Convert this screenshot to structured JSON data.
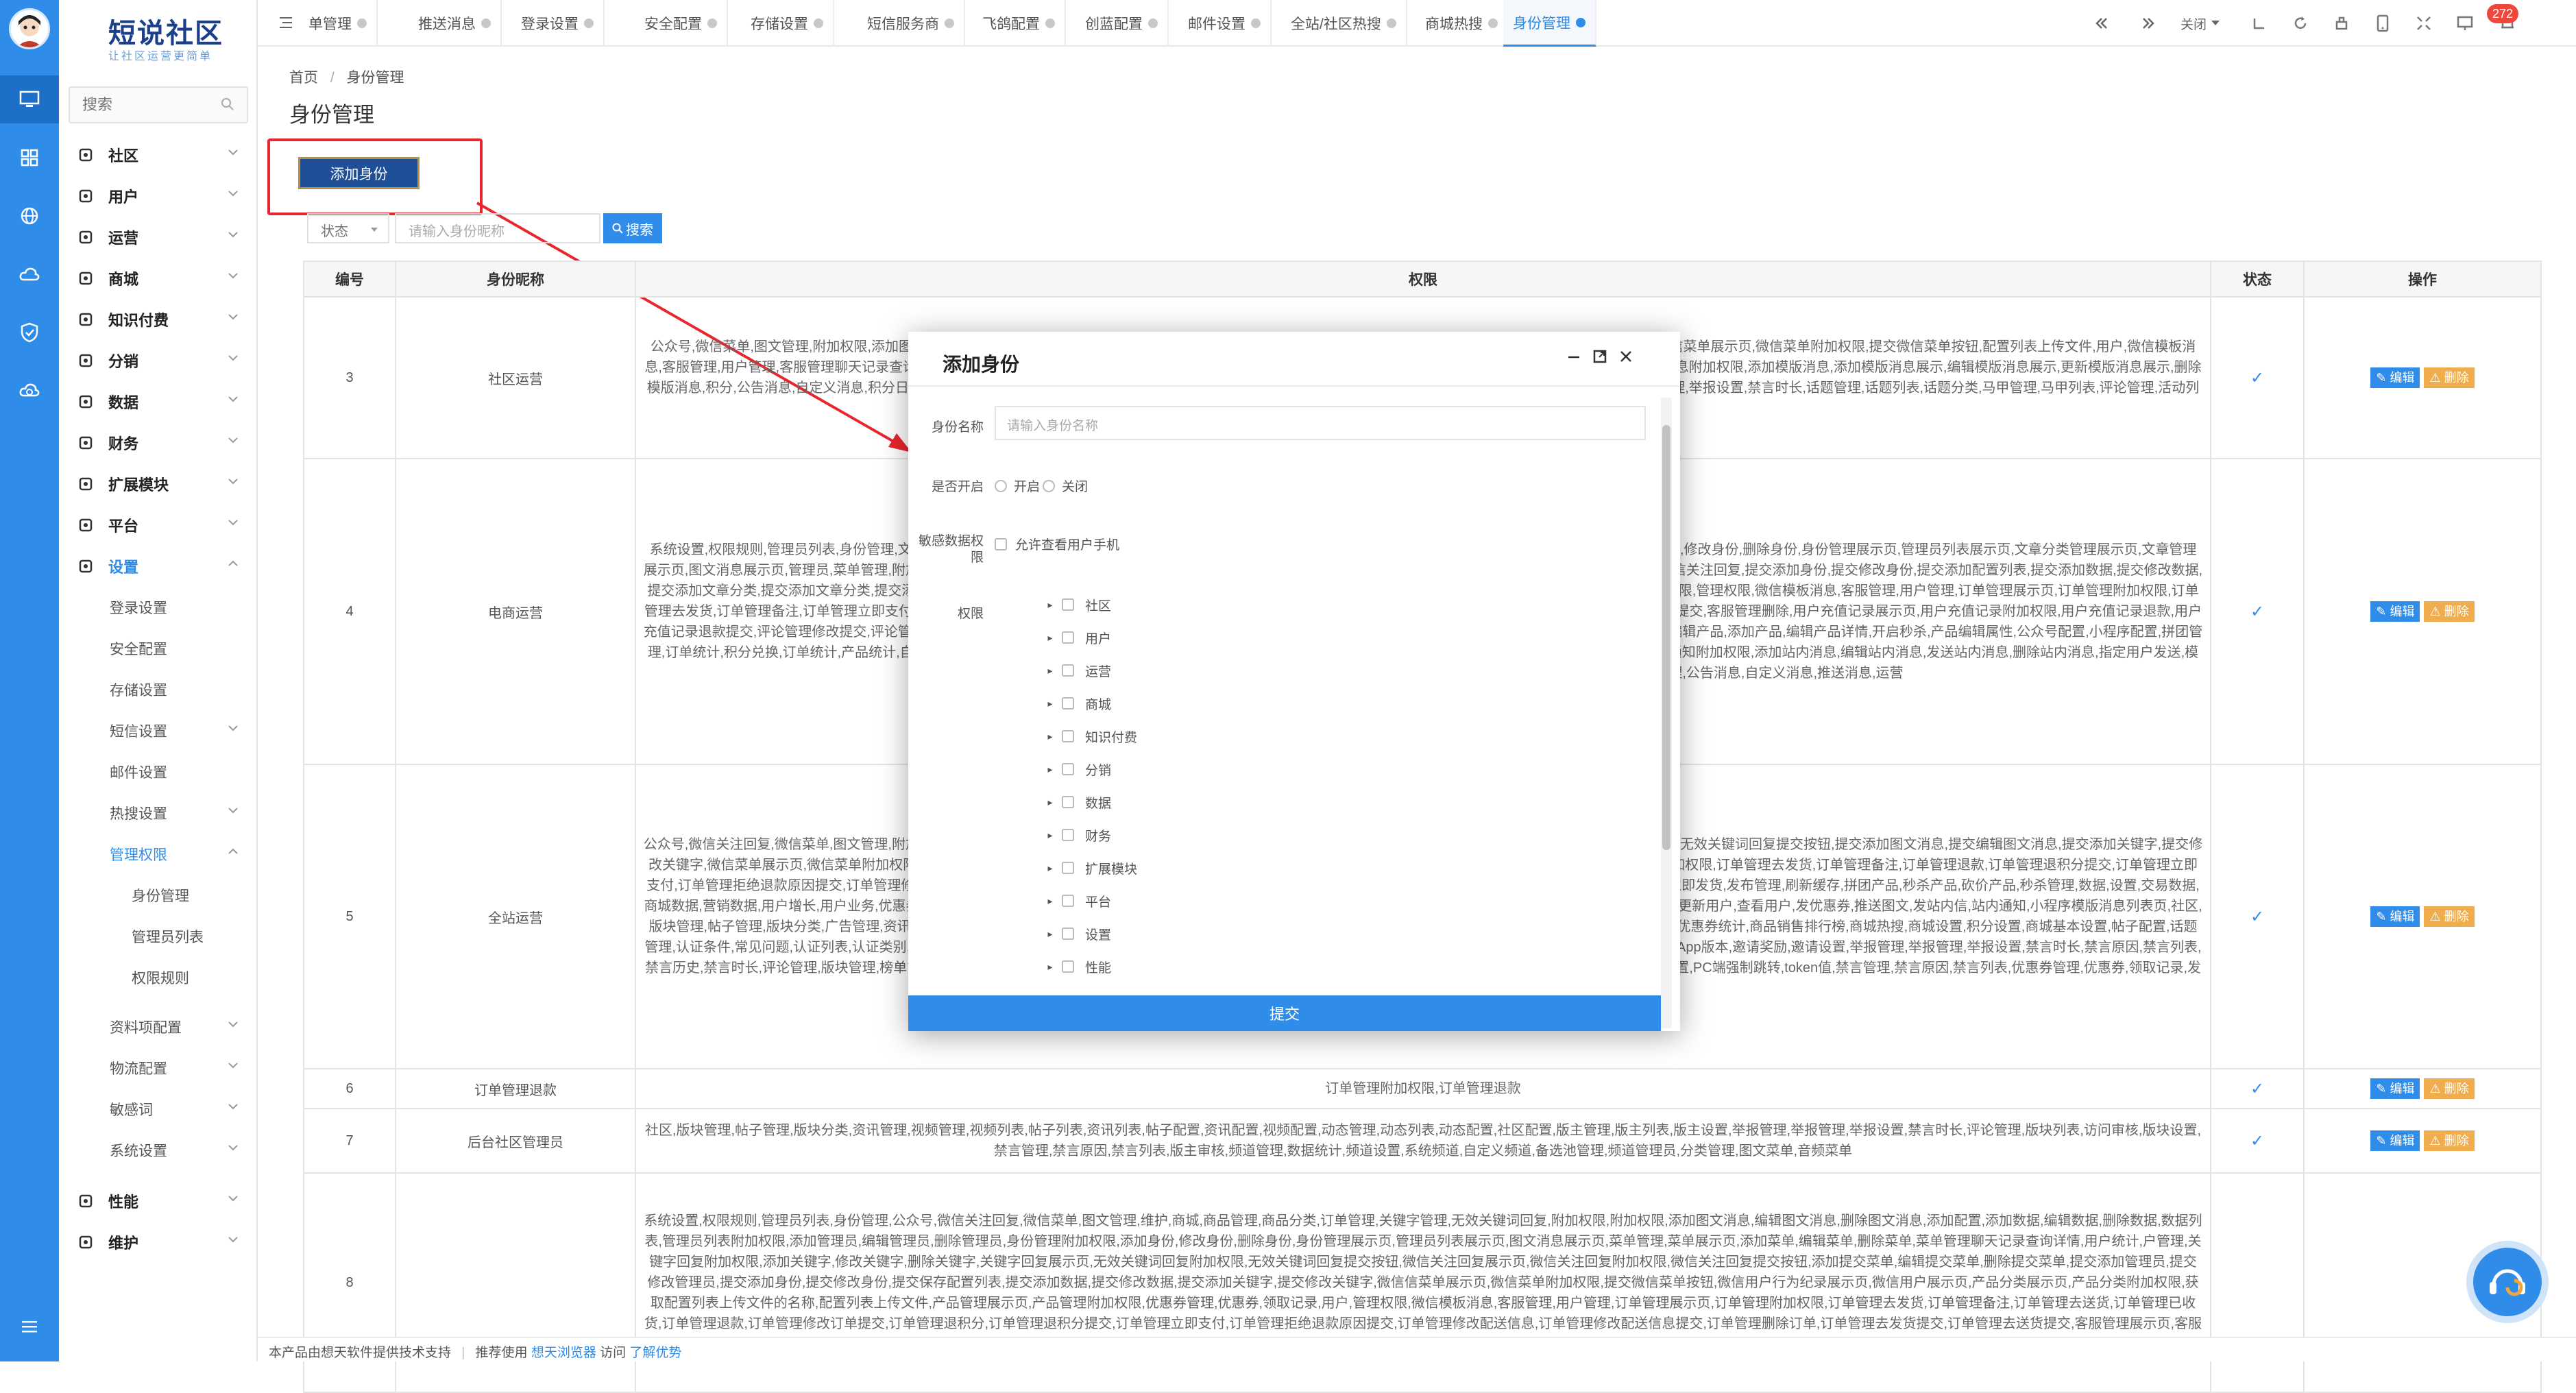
{
  "brand": {
    "title": "短说社区",
    "slogan": "让社区运营更简单"
  },
  "sidebar": {
    "search_placeholder": "搜索",
    "items": [
      {
        "label": "社区",
        "icon": "chat-icon"
      },
      {
        "label": "用户",
        "icon": "user-icon"
      },
      {
        "label": "运营",
        "icon": "operation-icon"
      },
      {
        "label": "商城",
        "icon": "store-icon"
      },
      {
        "label": "知识付费",
        "icon": "book-icon"
      },
      {
        "label": "分销",
        "icon": "share-icon"
      },
      {
        "label": "数据",
        "icon": "data-icon"
      },
      {
        "label": "财务",
        "icon": "finance-icon"
      },
      {
        "label": "扩展模块",
        "icon": "plugin-icon"
      },
      {
        "label": "平台",
        "icon": "platform-icon"
      },
      {
        "label": "设置",
        "icon": "gear-icon"
      }
    ],
    "settings_sub": [
      "登录设置",
      "安全配置",
      "存储设置",
      "短信设置",
      "邮件设置",
      "热搜设置",
      "管理权限"
    ],
    "perm_sub": [
      "身份管理",
      "管理员列表",
      "权限规则"
    ],
    "settings_sub2": [
      "资料项配置",
      "物流配置",
      "敏感词",
      "系统设置"
    ],
    "bottom": [
      {
        "label": "性能",
        "icon": "performance-icon"
      },
      {
        "label": "维护",
        "icon": "wrench-icon"
      }
    ]
  },
  "tabs": [
    "单管理",
    "推送消息",
    "登录设置",
    "安全配置",
    "存储设置",
    "短信服务商",
    "飞鸽配置",
    "创蓝配置",
    "邮件设置",
    "全站/社区热搜",
    "商城热搜",
    "身份管理"
  ],
  "toolbar": {
    "close_label": "关闭",
    "badge": "272"
  },
  "breadcrumb": {
    "home": "首页",
    "sep": "/",
    "current": "身份管理"
  },
  "page_title": "身份管理",
  "add_button": "添加身份",
  "filter": {
    "status": "状态",
    "name_placeholder": "请输入身份昵称",
    "search": "搜索"
  },
  "table": {
    "headers": [
      "编号",
      "身份昵称",
      "权限",
      "状态",
      "操作"
    ],
    "edit": "编辑",
    "del": "删除",
    "rows": [
      {
        "id": "3",
        "name": "社区运营",
        "perm": "公众号,微信菜单,图文管理,附加权限,添加图文消息,编辑图文消息,删除图文消息,图文消息展示页,微信用户管理,提交添加图文消息,提交编辑图文消息,提交保存配置列表,微信菜单展示页,微信菜单附加权限,提交微信菜单按钮,配置列表上传文件,用户,微信模板消息,客服管理,用户管理,客服管理聊天记录查询详情,用户统计,公众号配置,小程序配置,数据,设置,商城数据,用户增长,用户业务,公众号微信推送,推送图文,发站内信,微信模板消息附加权限,添加模版消息,添加模版消息展示,编辑模版消息展示,更新模版消息展示,删除模版消息,积分,公告消息,自定义消息,积分日志,积分商城,商品管理,订单管理,栏目管理,基础设置,邀请海报,认证特权,认证条件,常见问题,邀请奖励,邀请设置,举报管理,举报管理,举报设置,禁言时长,话题管理,话题列表,话题分类,马甲管理,马甲列表,评论管理,活动列表,活动分类,活动管理,活动配置,微信流量主广告,发布页广告,钱包设置,提"
      },
      {
        "id": "4",
        "name": "电商运营",
        "perm": "系统设置,权限规则,管理员列表,身份管理,文章分类,删除文章分类,附加权限,附加权限,添加文章,编辑文章,删除文章,附加权限,添加图文消息,编辑图文消息,附加权限,添加身份,修改身份,删除身份,身份管理展示页,管理员列表展示页,文章分类管理展示页,文章管理展示页,图文消息展示页,管理员,菜单管理,附加权限,修改关键字,删除关键字,关键字回复展示页,无效关键词回复展示页,无效关键词回复附加权限,无效关键词回复提交按钮,微信关注回复,提交添加身份,提交修改身份,提交添加配置列表,提交添加数据,提交修改数据,提交添加文章分类,提交添加文章分类,提交添加菜单展示页,微信菜单附加权限,提交微信菜单按钮,微信用户行为记录展示页,微信用户展示页,产品分类展示页,产品分类附加权限,管理权限,微信模板消息,客服管理,用户管理,订单管理展示页,订单管理附加权限,订单管理去发货,订单管理备注,订单管理立即支付,订单管理拒绝退款原因提交,订单管理修改配送信息,订单管理修改配送信息提交,订单管理修改数据,客服管理编辑,客服管理编辑提交,客服管理删除,用户充值记录展示页,用户充值记录附加权限,用户充值记录退款,用户充值记录退款提交,评论管理修改提交,评论管理删除评论,优惠券管理展示页,优惠券管理附加权限,优惠券管理添加,优惠券管理添加提交,优惠券管理删除,资料配置,后台通知,编辑产品,添加产品,编辑产品详情,开启秒杀,产品编辑属性,公众号配置,小程序配置,拼团管理,订单统计,积分兑换,订单统计,产品统计,自动回复,公众号微信支付,其它权限管理,编辑砍价,添加产品分类,编辑产品分类,物流公司,商户,发优惠券,推送图文,发站内信,站内通知附加权限,添加站内消息,编辑站内消息,发送站内消息,删除站内消息,指定用户发送,模版消息展示,小程序模版消息附加权限,添加模版消息展示,添加模版消息,编辑模版消息展示,编辑模版消息,飞鸽配置,广告管理,公告消息,自定义消息,推送消息,运营"
      },
      {
        "id": "5",
        "name": "全站运营",
        "perm": "公众号,微信关注回复,微信菜单,图文管理,附加权限,添加图文消息,图文消息展示页,微信用户管理,关键字回复附加权限,添加关键字,修改关键字,删除关键字,关键字回复展示页,无效关键词回复提交按钮,提交添加图文消息,提交编辑图文消息,提交添加关键字,提交修改关键字,微信菜单展示页,微信菜单附加权限,提交微信菜单按钮,附加权限,优惠券管理,优惠券,领取记录,用户,微信模板消息,客服管理,用户管理,订单管理展示页,订单管理附加权限,订单管理去发货,订单管理备注,订单管理退款,订单管理退积分提交,订单管理立即支付,订单管理拒绝退款原因提交,订单管理修改配送信息,客服管理聊天记录查询,客服管理添加,客服管理添加提交,客服管理编辑,客服管理编辑提交,客服管理删除,客服管理立即发货,发布管理,刷新缓存,拼团产品,秒杀产品,砍价产品,秒杀管理,数据,设置,交易数据,商城数据,营销数据,用户增长,用户业务,优惠券统计,拼团统计,秒杀统计,营销订单,拼团列表,秒杀列表,砍价列表,推送优惠券,会员列表页,会员用户管理,修改用户状态,编辑用户,更新用户,查看用户,发优惠券,推送图文,发站内信,站内通知,小程序模版消息列表页,社区,版块管理,帖子管理,版块分类,广告管理,资讯管理,视频管理,视频列表,帖子列表,资讯列表,用户等级,用户权限,积分,邀请奖励,邀请设置,举报管理,数据统计,订单统计,产品统计,优惠券统计,商品销售排行榜,商城热搜,商城设置,积分设置,商城基本设置,帖子配置,话题管理,认证条件,常见问题,认证列表,认证类别,认证配置,小程序,推送消息,运营,知识付费,作者管理,分销商,视频配置,分销配置,任务管理,社区配置,版主管理,版主列表,版主设置,App版本,邀请奖励,邀请设置,举报管理,举报管理,举报设置,禁言时长,禁言原因,禁言列表,禁言历史,禁言时长,评论管理,版块管理,榜单管理,评论管理,用户组,系统用户组,晋级用户组,会员用户组,认证用户组,自定义用户组,小程序微信支付,版块列表,访问审核,版块设置,PC端强制跳转,token值,禁言管理,禁言原因,禁言列表,优惠券管理,优惠券,领取记录,发布管理"
      },
      {
        "id": "6",
        "name": "订单管理退款",
        "perm": "订单管理附加权限,订单管理退款"
      },
      {
        "id": "7",
        "name": "后台社区管理员",
        "perm": "社区,版块管理,帖子管理,版块分类,资讯管理,视频管理,视频列表,帖子列表,资讯列表,帖子配置,资讯配置,视频配置,动态管理,动态列表,动态配置,社区配置,版主管理,版主列表,版主设置,举报管理,举报管理,举报设置,禁言时长,评论管理,版块列表,访问审核,版块设置,禁言管理,禁言原因,禁言列表,版主审核,频道管理,数据统计,频道设置,系统频道,自定义频道,备选池管理,频道管理员,分类管理,图文菜单,音频菜单"
      },
      {
        "id": "8",
        "name": "",
        "perm": "系统设置,权限规则,管理员列表,身份管理,公众号,微信关注回复,微信菜单,图文管理,维护,商城,商品管理,商品分类,订单管理,关键字管理,无效关键词回复,附加权限,附加权限,添加图文消息,编辑图文消息,删除图文消息,添加配置,添加数据,编辑数据,删除数据,数据列表,管理员列表附加权限,添加管理员,编辑管理员,删除管理员,身份管理附加权限,添加身份,修改身份,删除身份,身份管理展示页,管理员列表展示页,图文消息展示页,菜单管理,菜单展示页,添加菜单,编辑菜单,删除菜单,菜单管理聊天记录查询详情,用户统计,户管理,关键字回复附加权限,添加关键字,修改关键字,删除关键字,关键字回复展示页,无效关键词回复附加权限,无效关键词回复提交按钮,微信关注回复展示页,微信关注回复附加权限,微信关注回复提交按钮,添加提交菜单,编辑提交菜单,删除提交菜单,提交添加管理员,提交修改管理员,提交添加身份,提交修改身份,提交保存配置列表,提交添加数据,提交修改数据,提交添加关键字,提交修改关键字,微信信菜单展示页,微信菜单附加权限,提交微信菜单按钮,微信用户行为纪录展示页,微信用户展示页,产品分类展示页,产品分类附加权限,获取配置列表上传文件的名称,配置列表上传文件,产品管理展示页,产品管理附加权限,优惠券管理,优惠券,领取记录,用户,管理权限,微信模板消息,客服管理,用户管理,订单管理展示页,订单管理附加权限,订单管理去发货,订单管理备注,订单管理去送货,订单管理已收货,订单管理退款,订单管理修改订单提交,订单管理退积分,订单管理退积分提交,订单管理立即支付,订单管理拒绝退款原因提交,订单管理修改配送信息,订单管理修改配送信息提交,订单管理删除订单,订单管理去发货提交,订单管理去送货提交,客服管理展示页,客服管理附加权限,客服管理添加"
      }
    ]
  },
  "modal": {
    "title": "添加身份",
    "name_label": "身份名称",
    "name_placeholder": "请输入身份名称",
    "open_label": "是否开启",
    "open_on": "开启",
    "open_off": "关闭",
    "sensitive_label": "敏感数据权限",
    "sensitive_text": "允许查看用户手机",
    "perm_label": "权限",
    "tree": [
      "社区",
      "用户",
      "运营",
      "商城",
      "知识付费",
      "分销",
      "数据",
      "财务",
      "扩展模块",
      "平台",
      "设置",
      "性能"
    ],
    "submit": "提交"
  },
  "footer": {
    "text1": "本产品由想天软件提供技术支持",
    "sep": "|",
    "text2": "推荐使用",
    "browser": "想天浏览器",
    "text3": "访问",
    "link": "了解优势"
  },
  "colors": {
    "primary": "#2f8ce8",
    "dark_button": "#1f4f97",
    "highlight_red": "#e8262d",
    "warning": "#f0ad4e"
  }
}
